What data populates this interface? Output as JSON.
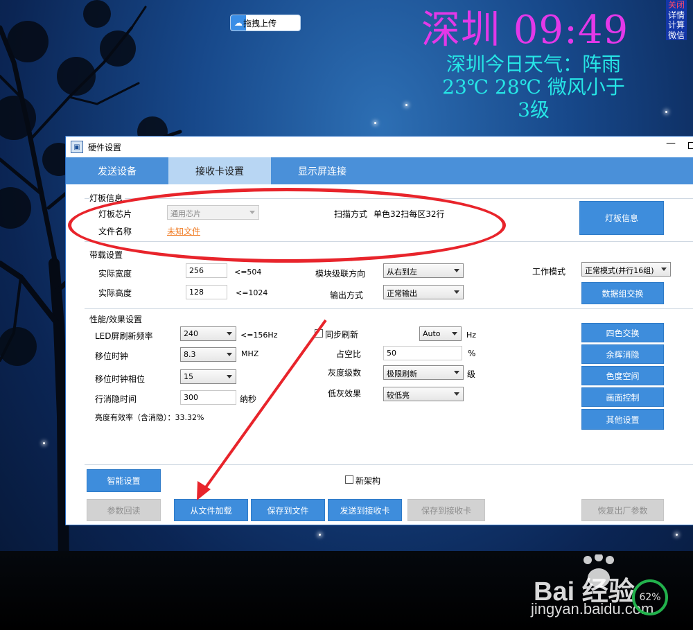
{
  "desktop": {
    "upload_label": "拖拽上传",
    "clock": "深圳 09:49",
    "weather": "深圳今日天气：阵雨 23℃ 28℃ 微风小于3级",
    "side_menu": [
      "关闭",
      "详情",
      "计算",
      "微信"
    ],
    "colors": {
      "clock": "#e338e8",
      "weather": "#26e6e6",
      "accent": "#4a90d9",
      "highlight_oval": "#e8242b"
    }
  },
  "window": {
    "title": "硬件设置",
    "tabs": [
      {
        "label": "发送设备",
        "active": false
      },
      {
        "label": "接收卡设置",
        "active": true
      },
      {
        "label": "显示屏连接",
        "active": false
      }
    ]
  },
  "board_info": {
    "title": "灯板信息",
    "chip_label": "灯板芯片",
    "chip_value": "通用芯片",
    "file_label": "文件名称",
    "file_value": "未知文件",
    "scan_label": "扫描方式",
    "scan_value": "单色32扫每区32行",
    "info_button": "灯板信息"
  },
  "load_settings": {
    "title": "带载设置",
    "width_label": "实际宽度",
    "width_value": "256",
    "width_limit": "<=504",
    "height_label": "实际高度",
    "height_value": "128",
    "height_limit": "<=1024",
    "cascade_label": "模块级联方向",
    "cascade_value": "从右到左",
    "output_label": "输出方式",
    "output_value": "正常输出",
    "work_label": "工作模式",
    "work_value": "正常模式(并行16组)",
    "swap_button": "数据组交换"
  },
  "perf": {
    "title": "性能/效果设置",
    "refresh_label": "LED屏刷新频率",
    "refresh_value": "240",
    "refresh_limit": "<=156Hz",
    "shift_label": "移位时钟",
    "shift_value": "8.3",
    "shift_unit": "MHZ",
    "phase_label": "移位时钟相位",
    "phase_value": "15",
    "blank_label": "行消隐时间",
    "blank_value": "300",
    "blank_unit": "纳秒",
    "efficiency": "亮度有效率（含消隐）：33.32%",
    "sync_label": "同步刷新",
    "sync_value": "Auto",
    "sync_unit": "Hz",
    "duty_label": "占空比",
    "duty_value": "50",
    "duty_unit": "%",
    "gray_label": "灰度级数",
    "gray_value": "极限刷新",
    "gray_unit": "级",
    "lowgray_label": "低灰效果",
    "lowgray_value": "较低亮",
    "side_buttons": [
      "四色交换",
      "余辉消隐",
      "色度空间",
      "画面控制",
      "其他设置"
    ]
  },
  "footer": {
    "smart_button": "智能设置",
    "new_arch_label": "新架构",
    "buttons": {
      "readback": "参数回读",
      "load_file": "从文件加载",
      "save_file": "保存到文件",
      "send_card": "发送到接收卡",
      "save_card": "保存到接收卡",
      "factory": "恢复出厂参数"
    }
  },
  "watermark": {
    "brand": "Bai 经验",
    "url": "jingyan.baidu.com",
    "ring_value": "62%"
  }
}
